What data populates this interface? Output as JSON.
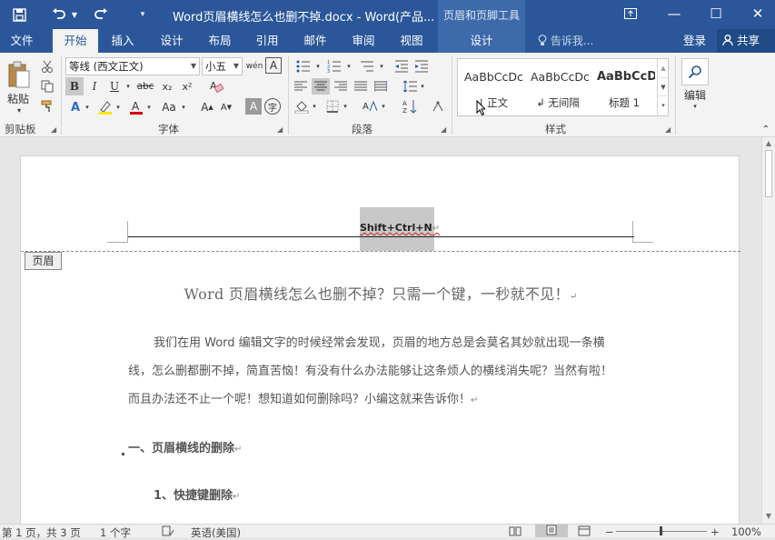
{
  "title_bar": {
    "save_icon": "save-icon",
    "undo_icon": "undo-icon",
    "redo_icon": "redo-icon",
    "customize_icon": "customize-toolbar-icon",
    "document_title": "Word页眉横线怎么也删不掉.docx - Word(产品...",
    "context_tool_title": "页眉和页脚工具",
    "ribbon_display_icon": "ribbon-display-icon",
    "minimize": "—",
    "maximize": "☐",
    "close": "✕"
  },
  "tabs": [
    {
      "label": "文件"
    },
    {
      "label": "开始"
    },
    {
      "label": "插入"
    },
    {
      "label": "设计"
    },
    {
      "label": "布局"
    },
    {
      "label": "引用"
    },
    {
      "label": "邮件"
    },
    {
      "label": "审阅"
    },
    {
      "label": "视图"
    },
    {
      "label": "设计"
    }
  ],
  "tell_me": "告诉我...",
  "login": "登录",
  "share": "共享",
  "ribbon": {
    "clipboard": {
      "paste_label": "粘贴",
      "group_label": "剪贴板"
    },
    "font": {
      "font_name": "等线 (西文正文)",
      "font_size": "小五",
      "bold": "B",
      "italic": "I",
      "underline": "U",
      "strikethrough": "abc",
      "subscript": "x₂",
      "superscript": "x²",
      "grow": "A",
      "shrink": "A",
      "change_case": "Aa",
      "group_label": "字体"
    },
    "paragraph": {
      "group_label": "段落"
    },
    "styles": {
      "items": [
        {
          "sample": "AaBbCcDc",
          "name": "↲ 正文"
        },
        {
          "sample": "AaBbCcDc",
          "name": "↲ 无间隔"
        },
        {
          "sample": "AaBbCcD",
          "name": "标题 1"
        }
      ],
      "group_label": "样式"
    },
    "editing": {
      "label": "编辑"
    }
  },
  "document": {
    "header_text": "Shift+Ctrl+N",
    "header_tag": "页眉",
    "title": "Word 页眉横线怎么也删不掉？只需一个键，一秒就不见！",
    "paragraph_lines": [
      "我们在用 Word 编辑文字的时候经常会发现，页眉的地方总是会莫名其妙就出现一条横",
      "线，怎么删都删不掉，简直苦恼！有没有什么办法能够让这条烦人的横线消失呢？当然有啦！",
      "而且办法还不止一个呢！想知道如何删除吗？小编这就来告诉你！"
    ],
    "heading1": "一、页眉横线的删除",
    "heading2": "1、快捷键删除",
    "paragraph_mark": "↵"
  },
  "status_bar": {
    "page": "第 1 页，共 3 页",
    "words": "1 个字",
    "language": "英语(美国)",
    "zoom": "100%"
  }
}
